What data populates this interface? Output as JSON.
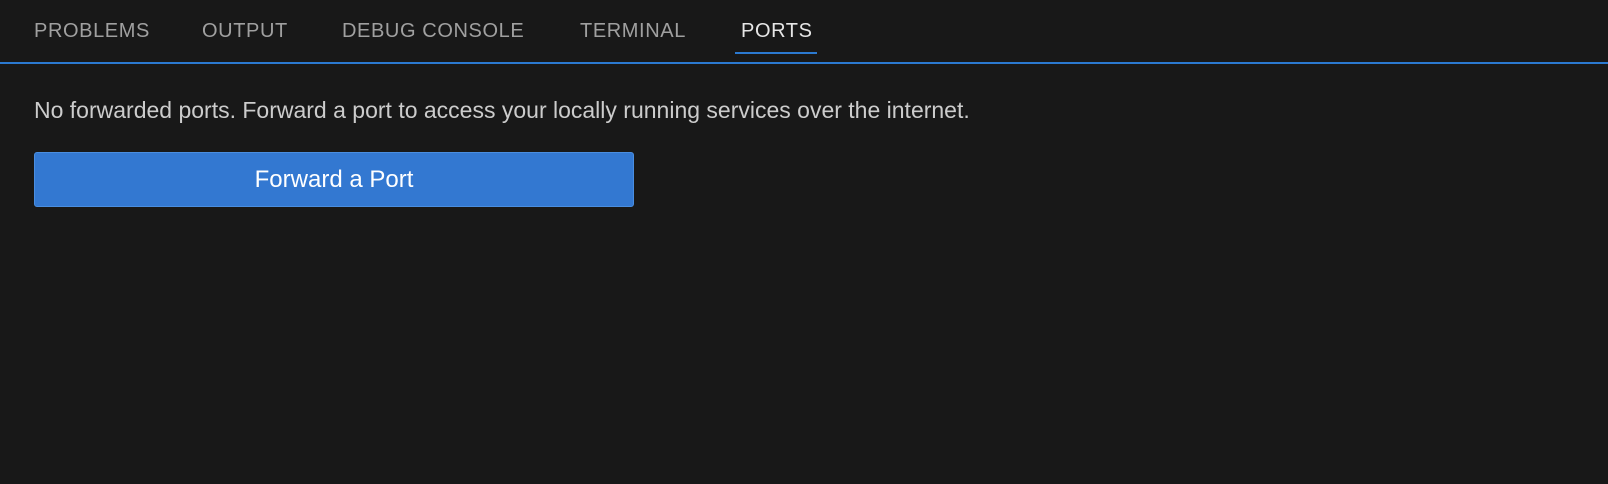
{
  "tabs": [
    {
      "label": "PROBLEMS",
      "active": false
    },
    {
      "label": "OUTPUT",
      "active": false
    },
    {
      "label": "DEBUG CONSOLE",
      "active": false
    },
    {
      "label": "TERMINAL",
      "active": false
    },
    {
      "label": "PORTS",
      "active": true
    }
  ],
  "ports": {
    "empty_message": "No forwarded ports. Forward a port to access your locally running services over the internet.",
    "forward_button_label": "Forward a Port"
  },
  "colors": {
    "background": "#181818",
    "accent": "#2b79d0",
    "button": "#3378d1"
  }
}
